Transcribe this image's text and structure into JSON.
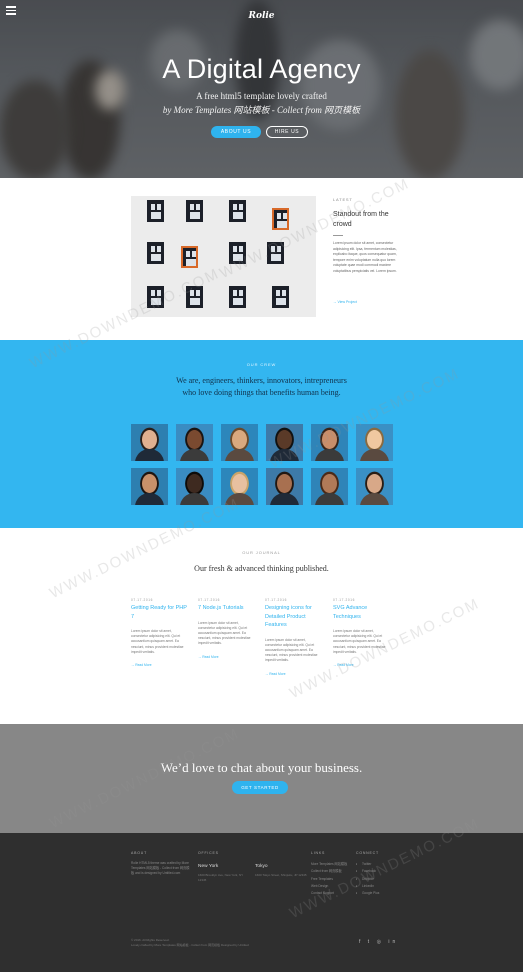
{
  "header": {
    "logo": "Rolie",
    "title": "A Digital Agency",
    "subtitle_line1": "A free html5 template lovely crafted",
    "subtitle_line2": "by More Templates 网站模板 - Collect from 网页模板",
    "about_button": "ABOUT US",
    "hire_button": "HIRE US"
  },
  "latest": {
    "kicker": "LATEST",
    "title": "Standout from the crowd",
    "body": "Lorem ipsum dolor sit amet, consectetur adipisicing elit. Ipsa, fermentum molestias, explicabo itaque, quos consequatur quam, tempore enim voluptatum nulla quo lorem voluptate quae modi commodi maxime voluptatibus perspiciatis vel. Lorem ipsum.",
    "link": "→ View Project"
  },
  "crew": {
    "kicker": "OUR CREW",
    "line1": "We are, engineers, thinkers, innovators, intrepreneurs",
    "line2": "who love doing things that benefits human being."
  },
  "journal": {
    "kicker": "OUR JOURNAL",
    "title": "Our fresh & advanced thinking published.",
    "posts": [
      {
        "date": "07.17.2016",
        "title": "Getting Ready for PHP 7",
        "excerpt": "Lorem ipsum dolor sit amet, consectetur adipisicing elit. Qui et accusantium quisquam amet. Ea nesciunt, minus provident molestiae impedit veritatis.",
        "more": "→ Read More"
      },
      {
        "date": "07.17.2016",
        "title": "7 Node.js Tutorials",
        "excerpt": "Lorem ipsum dolor sit amet, consectetur adipisicing elit. Qui et accusantium quisquam amet. Ea nesciunt, minus provident molestiae impedit veritatis.",
        "more": "→ Read More"
      },
      {
        "date": "07.17.2016",
        "title": "Designing icons for Detailed Product Features",
        "excerpt": "Lorem ipsum dolor sit amet, consectetur adipisicing elit. Qui et accusantium quisquam amet. Ea nesciunt, minus provident molestiae impedit veritatis.",
        "more": "→ Read More"
      },
      {
        "date": "07.17.2016",
        "title": "SVG Advance Techniques",
        "excerpt": "Lorem ipsum dolor sit amet, consectetur adipisicing elit. Qui et accusantium quisquam amet. Ea nesciunt, minus provident molestiae impedit veritatis.",
        "more": "→ Read More"
      }
    ]
  },
  "contact_band": {
    "title": "We’d love to chat about your business.",
    "button": "GET STARTED"
  },
  "footer": {
    "about": {
      "heading": "ABOUT",
      "text": "Rolie HTML5 theme was crafted by More Templates 网站模板 - Collect from 网页模板 and is designed by Untitled.com"
    },
    "offices": {
      "heading": "OFFICES",
      "city1": "New York",
      "addr1": "1600 Brooklyn Ave, New York, NY 12345",
      "city2": "Tokyo",
      "addr2": "1600 Tokyo Street, Shinjuku, JP 12345"
    },
    "links": {
      "heading": "LINKS",
      "items": [
        "More Templates 网站模板",
        "Collect from 网页模板",
        "Free Templates",
        "Web Design",
        "Contact Support"
      ]
    },
    "connect": {
      "heading": "CONNECT",
      "items": [
        "Twitter",
        "Facebook",
        "Dribbble",
        "LinkedIn",
        "Google Plus"
      ]
    },
    "copyright_line1": "© 2016. All Rights Reserved.",
    "copyright_line2": "Lovely crafted by More Templates 网站模板 - Collect from 网页模板 Designed by Untitled",
    "social_icons": [
      "f",
      "t",
      "◎",
      "in"
    ]
  },
  "watermark": "WWW.DOWNDEMO.COM"
}
